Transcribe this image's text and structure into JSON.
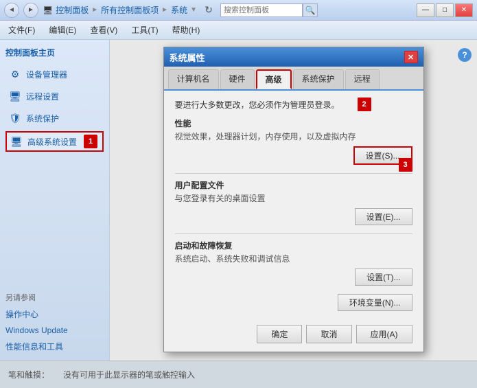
{
  "titlebar": {
    "nav_back": "◄",
    "nav_forward": "►",
    "address": {
      "icon": "🖥",
      "segment1": "控制面板",
      "arrow1": "►",
      "segment2": "所有控制面板项",
      "arrow2": "►",
      "segment3": "系统",
      "arrow3": "▼"
    },
    "refresh": "↻",
    "search_placeholder": "搜索控制面板",
    "search_icon": "🔍",
    "btn_minimize": "—",
    "btn_maximize": "□",
    "btn_close": "✕"
  },
  "toolbar": {
    "file": "文件(F)",
    "edit": "编辑(E)",
    "view": "查看(V)",
    "tools": "工具(T)",
    "help": "帮助(H)"
  },
  "sidebar": {
    "title": "控制面板主页",
    "items": [
      {
        "id": "device-mgr",
        "icon": "⚙",
        "label": "设备管理器"
      },
      {
        "id": "remote",
        "icon": "🖥",
        "label": "远程设置"
      },
      {
        "id": "system-protect",
        "icon": "🛡",
        "label": "系统保护"
      },
      {
        "id": "advanced",
        "icon": "🖥",
        "label": "高级系统设置",
        "active": true
      }
    ],
    "footer_title": "另请参阅",
    "footer_items": [
      {
        "label": "操作中心"
      },
      {
        "label": "Windows Update"
      },
      {
        "label": "性能信息和工具"
      }
    ]
  },
  "badge1": "1",
  "dialog": {
    "title": "系统属性",
    "tabs": [
      {
        "label": "计算机名"
      },
      {
        "label": "硬件"
      },
      {
        "label": "高级",
        "active": true
      },
      {
        "label": "系统保护"
      },
      {
        "label": "远程"
      }
    ],
    "note": "要进行大多数更改，您必须作为管理员登录。",
    "badge2": "2",
    "sections": [
      {
        "id": "performance",
        "title": "性能",
        "desc": "视觉效果，处理器计划，内存使用，以及虚拟内存",
        "btn_label": "设置(S)...",
        "btn_highlighted": true
      },
      {
        "id": "user-profiles",
        "title": "用户配置文件",
        "desc": "与您登录有关的桌面设置",
        "btn_label": "设置(E)..."
      },
      {
        "id": "startup",
        "title": "启动和故障恢复",
        "desc": "系统启动、系统失败和调试信息",
        "btn_label": "设置(T)..."
      }
    ],
    "badge3": "3",
    "env_btn": "环境变量(N)...",
    "footer": {
      "ok": "确定",
      "cancel": "取消",
      "apply": "应用(A)"
    },
    "help": "?"
  },
  "statusbar": {
    "left": "笔和触摸：",
    "right": "没有可用于此显示器的笔或触控输入"
  }
}
